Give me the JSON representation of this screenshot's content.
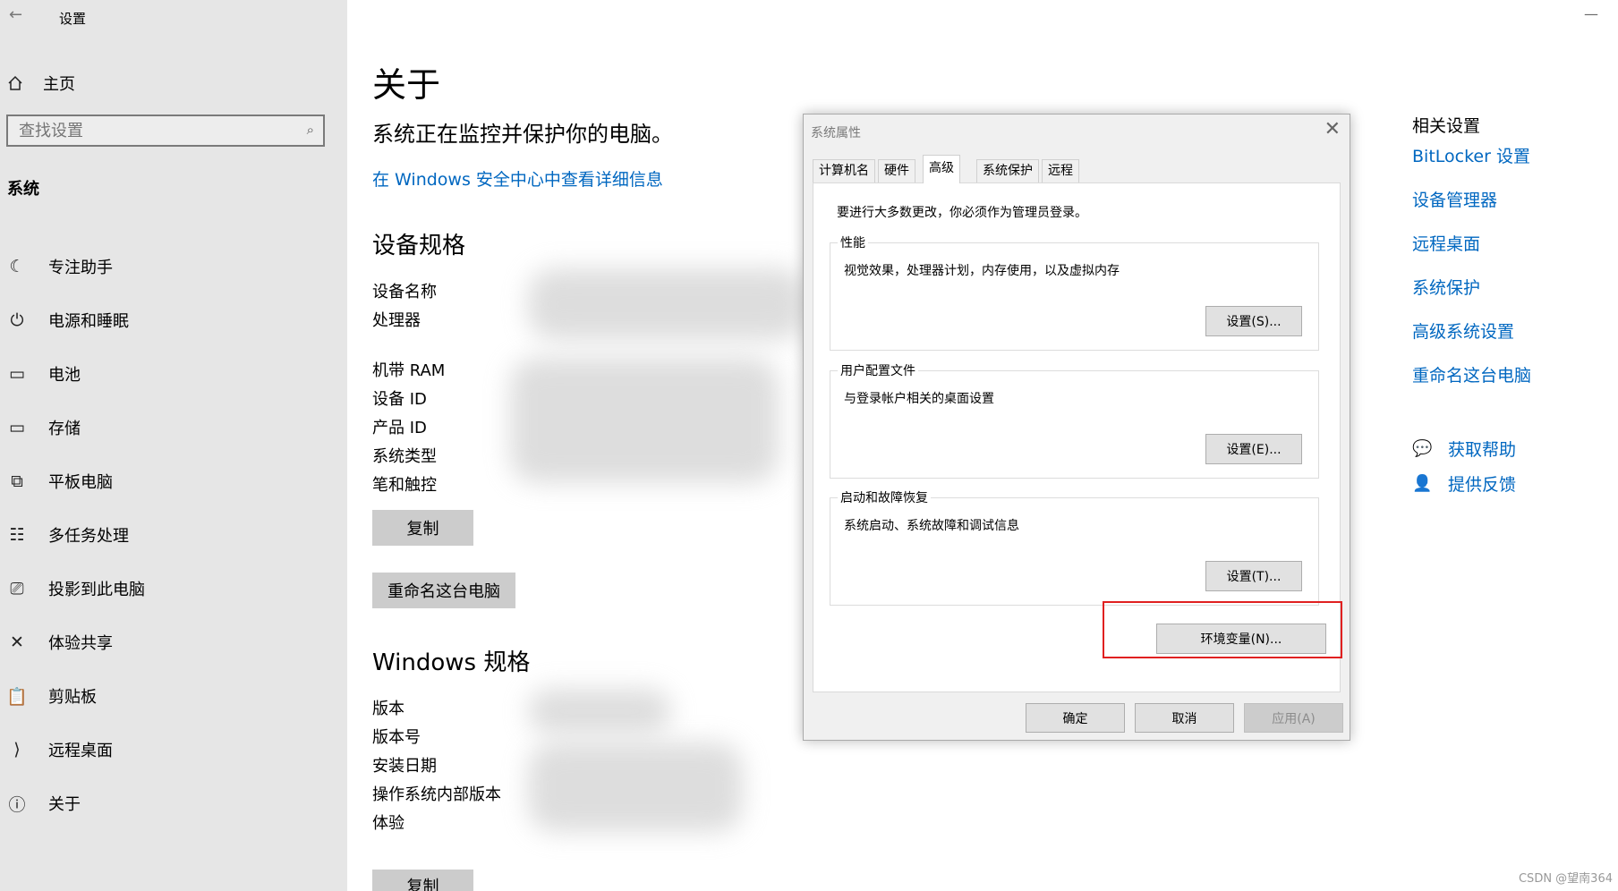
{
  "window": {
    "title": "设置",
    "back_icon": "back-arrow-icon",
    "minimize": "—"
  },
  "sidebar": {
    "home_label": "主页",
    "search_placeholder": "查找设置",
    "section": "系统",
    "items": [
      {
        "label": "专注助手",
        "icon": "moon-icon",
        "glyph": "☾"
      },
      {
        "label": "电源和睡眠",
        "icon": "power-icon",
        "glyph": "⏻"
      },
      {
        "label": "电池",
        "icon": "battery-icon",
        "glyph": "▭"
      },
      {
        "label": "存储",
        "icon": "storage-icon",
        "glyph": "▭"
      },
      {
        "label": "平板电脑",
        "icon": "tablet-icon",
        "glyph": "⧉"
      },
      {
        "label": "多任务处理",
        "icon": "multitask-icon",
        "glyph": "☷"
      },
      {
        "label": "投影到此电脑",
        "icon": "project-icon",
        "glyph": "⎚"
      },
      {
        "label": "体验共享",
        "icon": "share-icon",
        "glyph": "✕"
      },
      {
        "label": "剪贴板",
        "icon": "clipboard-icon",
        "glyph": "📋"
      },
      {
        "label": "远程桌面",
        "icon": "remote-icon",
        "glyph": "⟩"
      },
      {
        "label": "关于",
        "icon": "info-icon",
        "glyph": "ⓘ"
      }
    ]
  },
  "main": {
    "title": "关于",
    "status": "系统正在监控并保护你的电脑。",
    "security_link": "在 Windows 安全中心中查看详细信息",
    "device_specs": {
      "heading": "设备规格",
      "labels": [
        "设备名称",
        "处理器",
        "机带 RAM",
        "设备 ID",
        "产品 ID",
        "系统类型",
        "笔和触控"
      ],
      "copy": "复制",
      "rename": "重命名这台电脑"
    },
    "windows_specs": {
      "heading": "Windows 规格",
      "labels": [
        "版本",
        "版本号",
        "安装日期",
        "操作系统内部版本",
        "体验"
      ],
      "copy": "复制"
    }
  },
  "related": {
    "title": "相关设置",
    "links": [
      "BitLocker 设置",
      "设备管理器",
      "远程桌面",
      "系统保护",
      "高级系统设置",
      "重命名这台电脑"
    ],
    "help": {
      "label": "获取帮助",
      "icon": "help-chat-icon"
    },
    "feedback": {
      "label": "提供反馈",
      "icon": "feedback-icon"
    }
  },
  "dialog": {
    "title": "系统属性",
    "tabs": [
      "计算机名",
      "硬件",
      "高级",
      "系统保护",
      "远程"
    ],
    "active_tab": "高级",
    "note": "要进行大多数更改，你必须作为管理员登录。",
    "groups": [
      {
        "title": "性能",
        "desc": "视觉效果，处理器计划，内存使用，以及虚拟内存",
        "button": "设置(S)..."
      },
      {
        "title": "用户配置文件",
        "desc": "与登录帐户相关的桌面设置",
        "button": "设置(E)..."
      },
      {
        "title": "启动和故障恢复",
        "desc": "系统启动、系统故障和调试信息",
        "button": "设置(T)..."
      }
    ],
    "env_button": "环境变量(N)...",
    "ok": "确定",
    "cancel": "取消",
    "apply": "应用(A)"
  },
  "watermark": "CSDN @望南364",
  "colors": {
    "link": "#0067c0",
    "sidebar_bg": "#e6e6e6",
    "highlight": "#e02020"
  }
}
